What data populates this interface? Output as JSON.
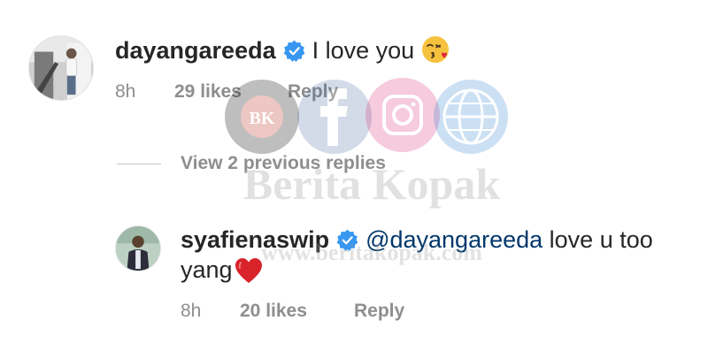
{
  "comments": [
    {
      "username": "dayangareeda",
      "text": "I love you",
      "emoji_icon": "kissing-face-emoji",
      "time": "8h",
      "likes": "29 likes",
      "reply_label": "Reply"
    }
  ],
  "replies_toggle": {
    "label": "View 2 previous replies"
  },
  "reply": {
    "username": "syafienaswip",
    "mention": "@dayangareeda",
    "text_line1": "love u too",
    "text_line2": "yang",
    "emoji_icon": "red-heart-emoji",
    "time": "8h",
    "likes": "20 likes",
    "reply_label": "Reply"
  },
  "watermark": {
    "title": "Berita Kopak",
    "url": "www.beritakopak.com",
    "logo": "BK",
    "icons": [
      "bk-logo-icon",
      "facebook-icon",
      "instagram-icon",
      "globe-www-icon"
    ]
  },
  "colors": {
    "text": "#262626",
    "secondary": "#8e8e8e",
    "verified": "#3897f0",
    "mention": "#00376b"
  }
}
